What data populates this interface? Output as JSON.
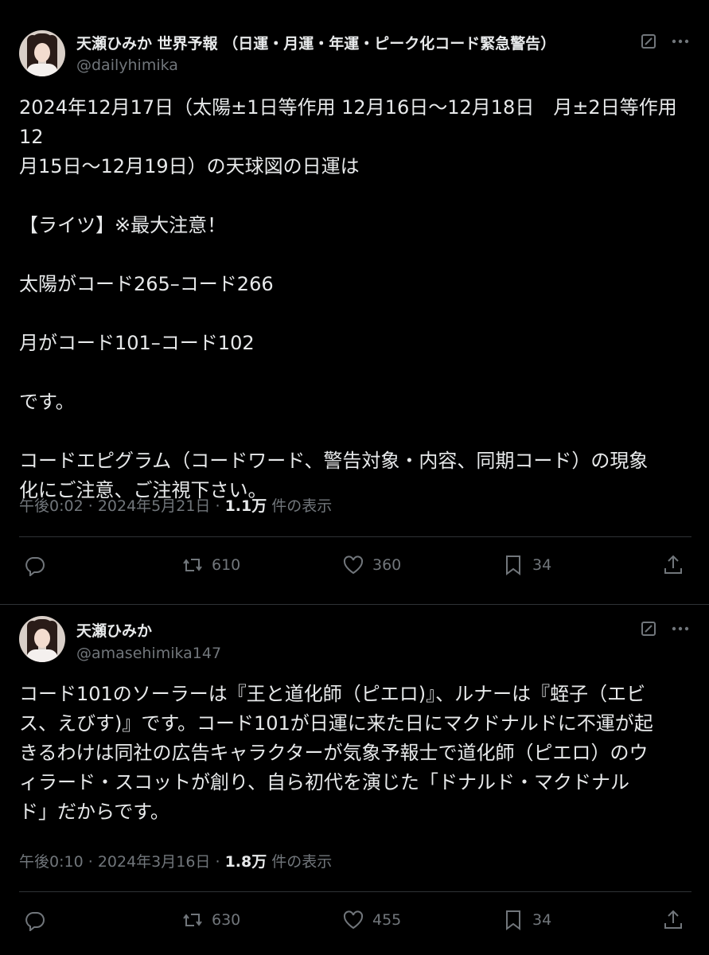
{
  "tweets": [
    {
      "display_name": "天瀬ひみか 世界予報 （日運・月運・年運・ピーク化コード緊急警告）",
      "handle": "@dailyhimika",
      "body": "2024年12月17日（太陽±1日等作用 12月16日〜12月18日　月±2日等作用 12\n月15日〜12月19日）の天球図の日運は\n\n【ライツ】※最大注意！\n\n太陽がコード265–コード266\n\n月がコード101–コード102\n\nです。\n\nコードエピグラム（コードワード、警告対象・内容、同期コード）の現象\n化にご注意、ご注視下さい。",
      "time": "午後0:02",
      "date": "2024年5月21日",
      "views": "1.1万",
      "views_label": "件の表示",
      "reposts": "610",
      "likes": "360",
      "bookmarks": "34"
    },
    {
      "display_name": "天瀬ひみか",
      "handle": "@amasehimika147",
      "body": "コード101のソーラーは『王と道化師（ピエロ)』、ルナーは『蛭子（エビ\nス、えびす)』です。コード101が日運に来た日にマクドナルドに不運が起\nきるわけは同社の広告キャラクターが気象予報士で道化師（ピエロ）のウ\nィラード・スコットが創り、自ら初代を演じた「ドナルド・マクドナル\nド」だからです。",
      "time": "午後0:10",
      "date": "2024年3月16日",
      "views": "1.8万",
      "views_label": "件の表示",
      "reposts": "630",
      "likes": "455",
      "bookmarks": "34"
    }
  ],
  "separator_dot": "·",
  "icons": [
    "edit-icon",
    "more-icon",
    "reply-icon",
    "repost-icon",
    "like-icon",
    "bookmark-icon",
    "share-icon"
  ],
  "colors": {
    "background": "#000000",
    "text": "#e7e9ea",
    "muted": "#71767b",
    "divider": "#2f3336"
  }
}
